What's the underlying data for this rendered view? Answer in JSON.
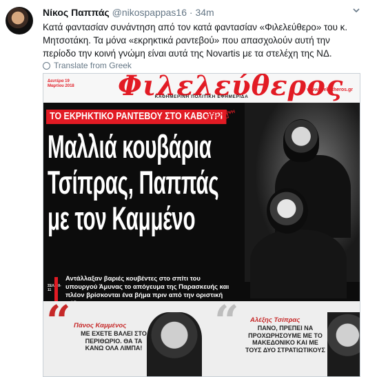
{
  "tweet": {
    "author_name": "Νίκος Παππάς",
    "handle": "@nikospappas16",
    "separator": "·",
    "time": "34m",
    "text": "Κατά φαντασίαν συνάντηση από τον κατά φαντασίαν «Φιλελεύθερο» του κ. Μητσοτάκη. Τα μόνα «εκρηκτικά ραντεβού» που απασχολούν αυτή την περίοδο την κοινή γνώμη είναι αυτά της Novartis με τα στελέχη της ΝΔ.",
    "translate_label": "Translate from Greek"
  },
  "newspaper": {
    "masthead": "Φιλελεύθερος",
    "date": "Δευτέρα 19 Μαρτίου 2018",
    "website": "www.fileleftheros.gr",
    "subtitle": "ΚΑΘΗΜΕΡΙΝΗ ΠΟΛΙΤΙΚΗ ΕΦΗΜΕΡΙΔΑ",
    "kicker": "ΤΟ ΕΚΡΗΚΤΙΚΟ ΡΑΝΤΕΒΟΥ ΣΤΟ ΚΑΒΟΥΡΙ",
    "stamp": "ΑΠΟΚΑΛΥΨΗ",
    "headline": [
      "Μαλλιά κουβάρια",
      "Τσίπρας, Παππάς",
      "με τον Καμμένο"
    ],
    "deck": "Αντάλλαξαν βαριές κουβέντες στο σπίτι του υπουργού Άμυνας το απόγευμα της Παρασκευής και πλέον βρίσκονται ένα βήμα πριν από την οριστική ρήξη",
    "page_ref": "ΣΕΛ. 10-11",
    "quote1": {
      "name": "Πάνος Καμμένος",
      "text": "ΜΕ ΕΧΕΤΕ ΒΑΛΕΙ ΣΤΟ ΠΕΡΙΘΩΡΙΟ. ΘΑ ΤΑ ΚΑΝΩ ΟΛΑ ΛΙΜΠΑ!"
    },
    "quote2": {
      "name": "Αλέξης Τσίπρας",
      "text": "ΠΑΝΟ, ΠΡΕΠΕΙ ΝΑ ΠΡΟΧΩΡΗΣΟΥΜΕ ΜΕ ΤΟ ΜΑΚΕΔΟΝΙΚΟ ΚΑΙ ΜΕ ΤΟΥΣ ΔΥΟ ΣΤΡΑΤΙΩΤΙΚΟΥΣ"
    }
  },
  "colors": {
    "accent_red": "#e21b24",
    "muted": "#657786"
  }
}
